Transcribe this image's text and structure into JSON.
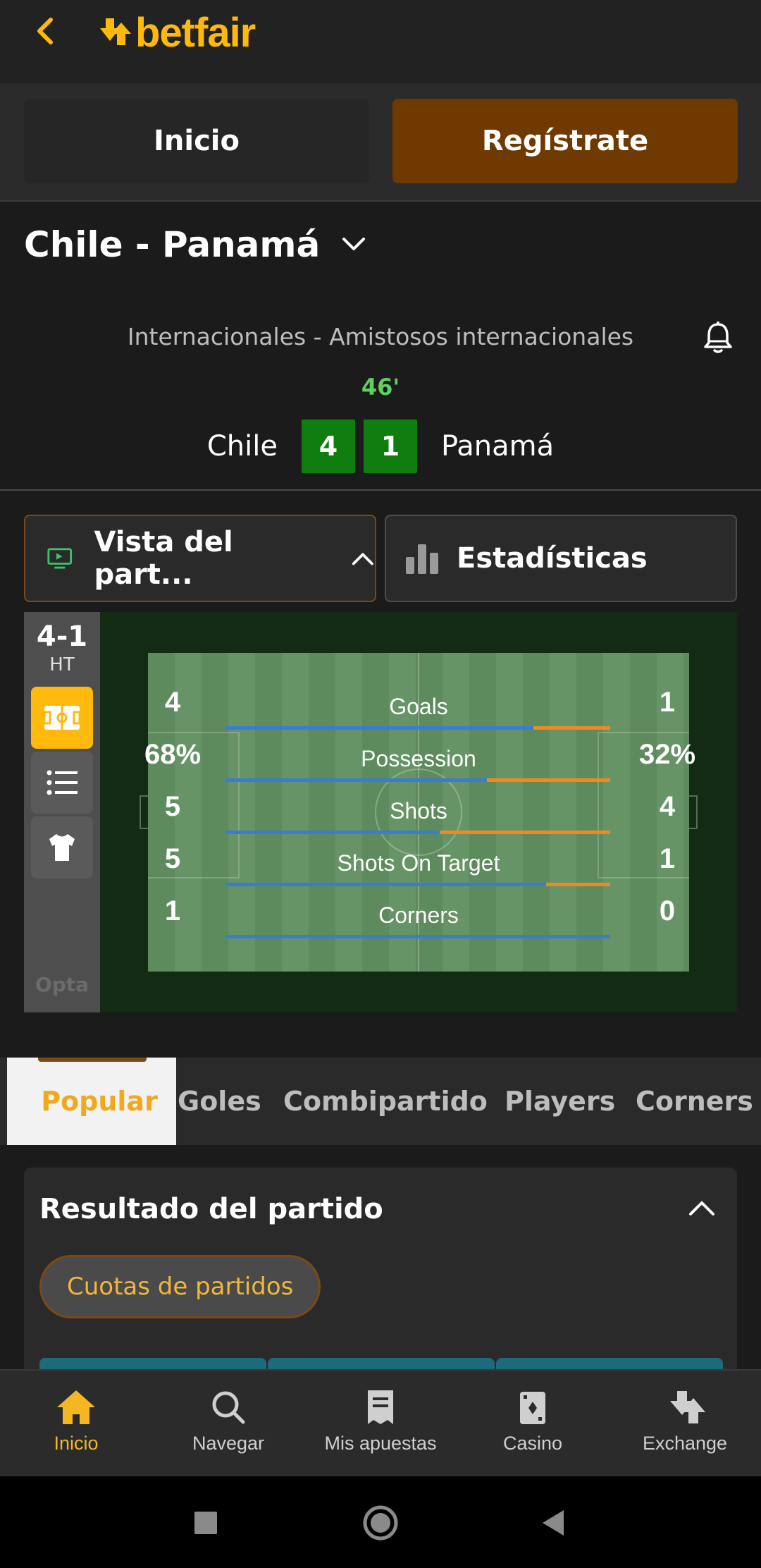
{
  "header": {
    "logo_text": "betfair"
  },
  "nav_buttons": {
    "home": "Inicio",
    "register": "Regístrate"
  },
  "match": {
    "title": "Chile - Panamá",
    "competition": "Internacionales - Amistosos internacionales",
    "minute": "46'",
    "home_team": "Chile",
    "away_team": "Panamá",
    "home_score": "4",
    "away_score": "1"
  },
  "toggles": {
    "view": "Vista del part...",
    "stats": "Estadísticas"
  },
  "widget": {
    "ht_score": "4-1",
    "ht_label": "HT",
    "provider": "Opta",
    "stats": [
      {
        "label": "Goals",
        "home": "4",
        "away": "1",
        "home_fraction": 0.8
      },
      {
        "label": "Possession",
        "home": "68%",
        "away": "32%",
        "home_fraction": 0.68
      },
      {
        "label": "Shots",
        "home": "5",
        "away": "4",
        "home_fraction": 0.556
      },
      {
        "label": "Shots On Target",
        "home": "5",
        "away": "1",
        "home_fraction": 0.833
      },
      {
        "label": "Corners",
        "home": "1",
        "away": "0",
        "home_fraction": 1.0
      }
    ]
  },
  "market_tabs": [
    "Popular",
    "Goles",
    "Combipartido",
    "Players",
    "Corners"
  ],
  "result_card": {
    "title": "Resultado del partido",
    "chip": "Cuotas de partidos"
  },
  "bottom_nav": [
    {
      "label": "Inicio",
      "icon": "home-icon",
      "active": true
    },
    {
      "label": "Navegar",
      "icon": "search-icon",
      "active": false
    },
    {
      "label": "Mis apuestas",
      "icon": "betslip-icon",
      "active": false
    },
    {
      "label": "Casino",
      "icon": "cards-icon",
      "active": false
    },
    {
      "label": "Exchange",
      "icon": "exchange-icon",
      "active": false
    }
  ],
  "colors": {
    "accent": "#ffb80c",
    "home_bar": "#3a7bd5",
    "away_bar": "#f0891e",
    "live": "#5fcf5f",
    "score_box": "#0f7d0f"
  }
}
